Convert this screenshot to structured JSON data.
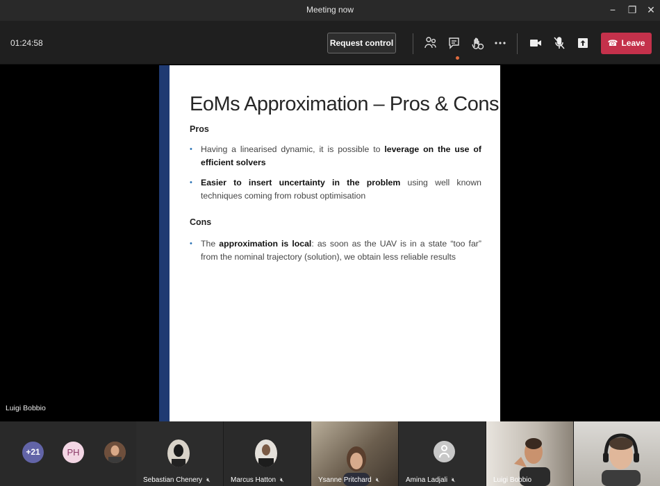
{
  "window": {
    "title": "Meeting now",
    "minimize": "−",
    "maximize": "❐",
    "close": "✕"
  },
  "toolbar": {
    "timer": "01:24:58",
    "request_control": "Request control",
    "leave_label": "Leave",
    "icons": [
      "participants-icon",
      "chat-icon",
      "reactions-icon",
      "more-icon",
      "camera-icon",
      "mic-off-icon",
      "share-icon",
      "phone-icon"
    ],
    "leave_color": "#c4314b"
  },
  "slide": {
    "title": "EoMs Approximation – Pros & Cons",
    "pros_heading": "Pros",
    "pros": [
      {
        "pre": "Having a linearised dynamic, it is possible to ",
        "bold": "leverage on the use of efficient solvers",
        "post": ""
      },
      {
        "pre": "",
        "bold": "Easier to insert uncertainty in the problem",
        "post": " using well known techniques coming from robust optimisation"
      }
    ],
    "cons_heading": "Cons",
    "cons": [
      {
        "pre": "The ",
        "bold": "approximation is local",
        "post": ": as soon as the UAV is in a state “too far” from the nominal trajectory (solution), we obtain less reliable results"
      }
    ],
    "accent_color": "#1f3a72"
  },
  "presenter": {
    "name": "Luigi Bobbio"
  },
  "participants": {
    "more_count": "+21",
    "initials": "PH",
    "tiles": [
      {
        "name": "Sebastian Chenery"
      },
      {
        "name": "Marcus Hatton"
      },
      {
        "name": "Ysanne Pritchard"
      },
      {
        "name": "Amina Ladjali"
      },
      {
        "name": "Luigi Bobbio"
      },
      {
        "name": ""
      }
    ]
  }
}
